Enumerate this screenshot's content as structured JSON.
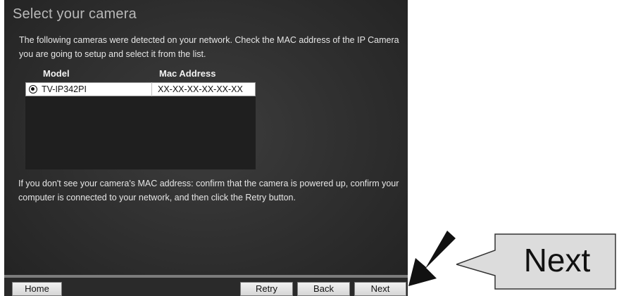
{
  "window": {
    "title": "Select your camera"
  },
  "intro_text": "The following cameras were detected on your network. Check the MAC address of the IP Camera you are going to setup and select it from the list.",
  "table": {
    "headers": [
      "Model",
      "Mac Address"
    ],
    "rows": [
      {
        "model": "TV-IP342PI",
        "mac": "XX-XX-XX-XX-XX-XX",
        "selected": true
      }
    ]
  },
  "help_text": "If you don't see your camera's MAC address: confirm that the camera is powered up, confirm your computer is connected to your network, and then click the Retry button.",
  "footer": {
    "home_label": "Home",
    "retry_label": "Retry",
    "back_label": "Back",
    "next_label": "Next"
  },
  "callout": {
    "label": "Next"
  },
  "icons": {
    "radio": "radio-selected-icon",
    "arrow": "pointer-arrow-icon"
  },
  "colors": {
    "panel": "#2e2e2e",
    "title": "#b9b9b9",
    "callout_fill": "#dcdcdc"
  }
}
